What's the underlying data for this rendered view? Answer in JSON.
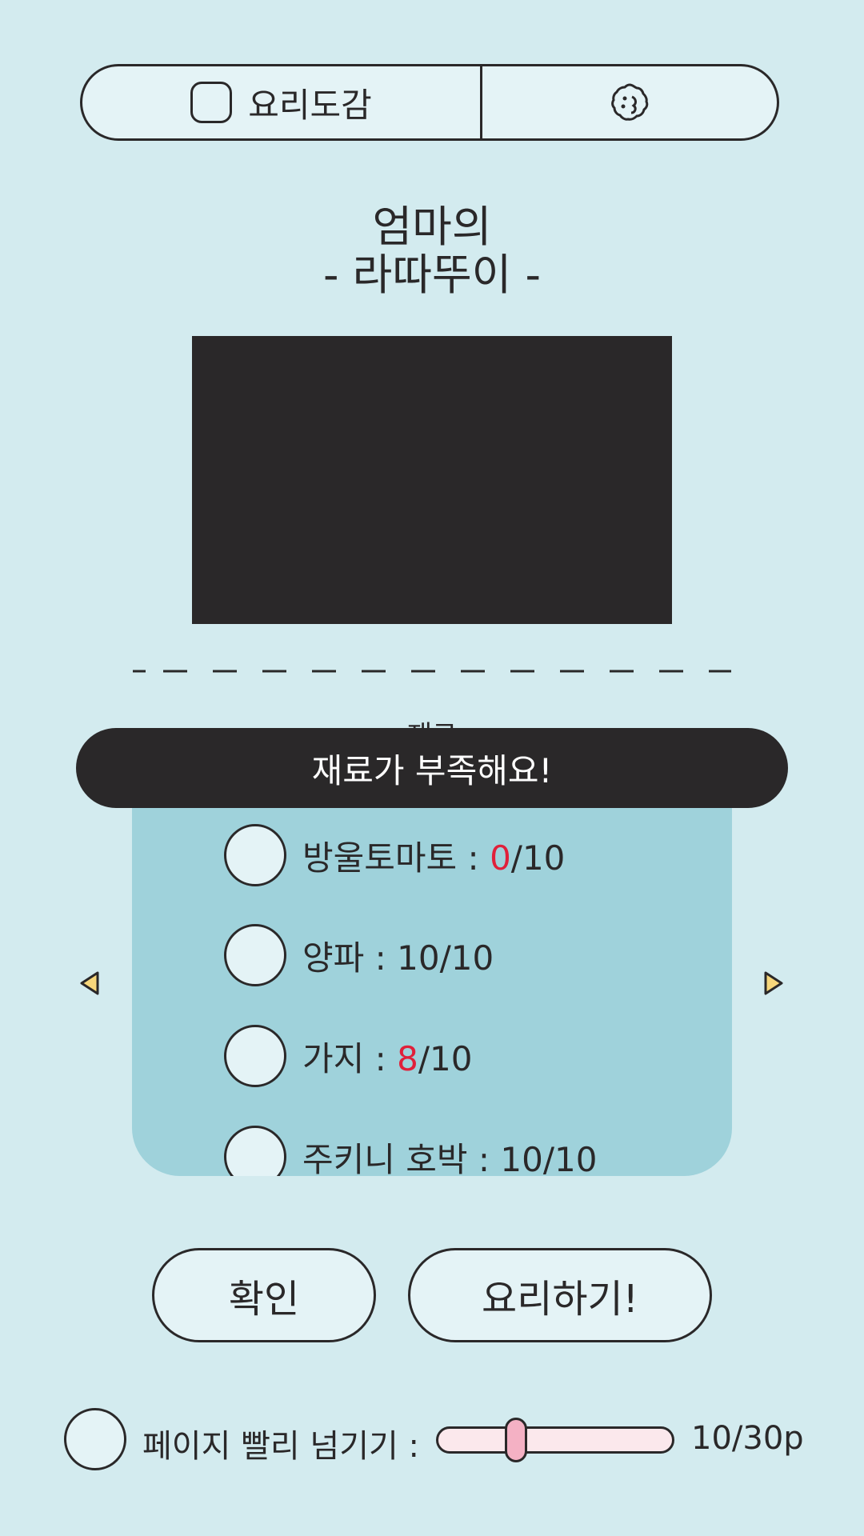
{
  "topbar": {
    "tab_cookbook": {
      "label": "요리도감",
      "icon": "book-icon"
    },
    "tab_secondary": {
      "icon": "cookie-icon"
    }
  },
  "recipe": {
    "title_line1": "엄마의",
    "title_line2": "- 라따뚜이 -"
  },
  "ingredients_section": {
    "label": "재료"
  },
  "toast": {
    "message": "재료가 부족해요!"
  },
  "ingredients": [
    {
      "name": "방울토마토 : ",
      "have": "0",
      "sep": "/",
      "need": "10",
      "insufficient": true
    },
    {
      "name": "양파 : ",
      "have": "10",
      "sep": "/",
      "need": "10",
      "insufficient": false
    },
    {
      "name": "가지 : ",
      "have": "8",
      "sep": "/",
      "need": "10",
      "insufficient": true
    },
    {
      "name": "주키니 호박 : ",
      "have": "10",
      "sep": "/",
      "need": "10",
      "insufficient": false
    }
  ],
  "colors": {
    "warning": "#e0203a",
    "accent_arrow": "#f7d77b",
    "slider_thumb": "#f4b1c4"
  },
  "buttons": {
    "confirm": "확인",
    "cook": "요리하기!"
  },
  "footer": {
    "fast_page_label": "페이지 빨리 넘기기 :",
    "page_indicator": "10/30p",
    "current_page": 10,
    "total_pages": 30
  }
}
